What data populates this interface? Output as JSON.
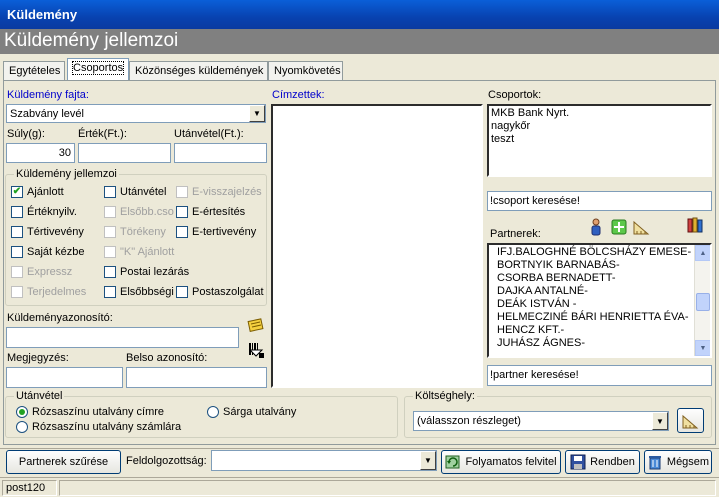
{
  "window": {
    "title": "Küldemény"
  },
  "header": {
    "title": "Küldemény jellemzoi"
  },
  "tabs": [
    {
      "label": "Egytételes"
    },
    {
      "label": "Csoportos"
    },
    {
      "label": "Közönséges küldemények"
    },
    {
      "label": "Nyomkövetés"
    }
  ],
  "form": {
    "kuldemeny_fajta_label": "Küldemény fajta:",
    "kuldemeny_fajta_value": "Szabvány levél",
    "suly_label": "Súly(g):",
    "suly_value": "30",
    "ertek_label": "Érték(Ft.):",
    "ertek_value": "",
    "utanvetel_label": "Utánvétel(Ft.):",
    "utanvetel_value": "",
    "jellemzok_title": "Küldemény jellemzoi",
    "checkboxes": [
      {
        "label": "Ajánlott",
        "checked": "✔"
      },
      {
        "label": "Értéknyilv.",
        "checked": ""
      },
      {
        "label": "Tértivevény",
        "checked": ""
      },
      {
        "label": "Saját kézbe",
        "checked": ""
      },
      {
        "label": "Expressz",
        "checked": ""
      },
      {
        "label": "Terjedelmes",
        "checked": ""
      },
      {
        "label": "Utánvétel",
        "checked": ""
      },
      {
        "label": "Elsőbb.cso",
        "checked": ""
      },
      {
        "label": "Törékeny",
        "checked": ""
      },
      {
        "label": "\"K\" Ajánlott",
        "checked": ""
      },
      {
        "label": "Postai lezárás",
        "checked": ""
      },
      {
        "label": "Elsőbbségi",
        "checked": ""
      },
      {
        "label": "E-visszajelzés",
        "checked": ""
      },
      {
        "label": "E-értesítés",
        "checked": ""
      },
      {
        "label": "E-tertivevény",
        "checked": ""
      },
      {
        "label": "Postaszolgálat",
        "checked": ""
      }
    ],
    "azonosito_label": "Küldeményazonosító:",
    "megjegyzes_label": "Megjegyzés:",
    "belso_label": "Belso azonosító:"
  },
  "cimzettek": {
    "label": "Címzettek:"
  },
  "csoportok": {
    "label": "Csoportok:",
    "items": [
      "MKB Bank Nyrt.",
      "nagykőr",
      "teszt"
    ],
    "search_value": "!csoport keresése!"
  },
  "partnerek": {
    "label": "Partnerek:",
    "items": [
      "IFJ.BALOGHNÉ BÖLCSHÁZY EMESE-",
      "BORTNYIK BARNABÁS-",
      "CSORBA BERNADETT-",
      "DAJKA ANTALNÉ-",
      "DEÁK ISTVÁN                -",
      "HELMECZINÉ BÁRI HENRIETTA ÉVA-",
      "HENCZ KFT.-",
      "JUHÁSZ ÁGNES-"
    ],
    "search_value": "!partner keresése!"
  },
  "utanvetel_group": {
    "title": "Utánvétel",
    "options": [
      "Rózsaszínu utalvány címre",
      "Rózsaszínu utalvány számlára",
      "Sárga utalvány"
    ]
  },
  "koltseghely": {
    "label": "Költséghely:",
    "value": "(válasszon részleget)"
  },
  "bottom": {
    "partnerek_szurese": "Partnerek szűrése",
    "feldolgozottsag_label": "Feldolgozottság:",
    "feldolgozottsag_value": "",
    "folyamatos_felvitel": "Folyamatos felvitel",
    "rendben": "Rendben",
    "megsem": "Mégsem"
  },
  "status": {
    "text": "post120"
  },
  "colors": {
    "titlebar": "#0842b0",
    "header": "#808080",
    "accent_green": "#21a121"
  }
}
